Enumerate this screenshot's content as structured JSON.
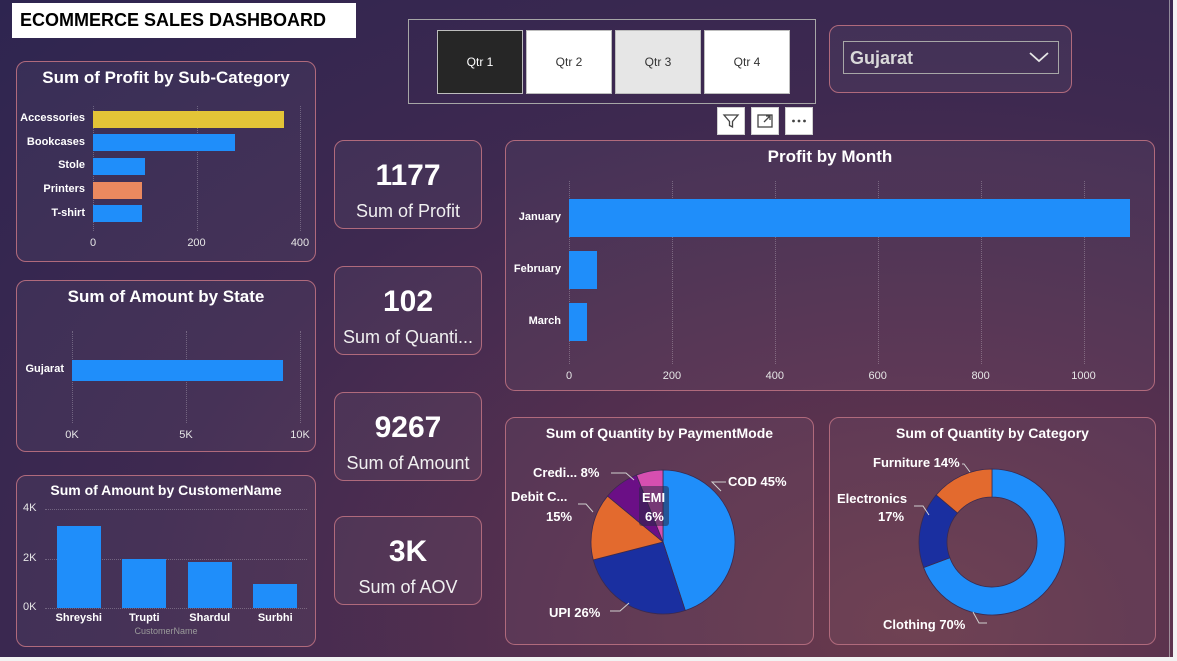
{
  "header": {
    "title": "ECOMMERCE SALES DASHBOARD"
  },
  "quarter_slicer": {
    "options": [
      "Qtr 1",
      "Qtr 2",
      "Qtr 3",
      "Qtr 4"
    ],
    "selected": "Qtr 1"
  },
  "state_dropdown": {
    "value": "Gujarat"
  },
  "visual_toolbar": {
    "icons": [
      "filter-icon",
      "focus-mode-icon",
      "more-options-icon"
    ]
  },
  "kpis": [
    {
      "value": "1177",
      "label": "Sum of Profit"
    },
    {
      "value": "102",
      "label": "Sum of Quanti..."
    },
    {
      "value": "9267",
      "label": "Sum of Amount"
    },
    {
      "value": "3K",
      "label": "Sum of AOV"
    }
  ],
  "colors": {
    "blue": "#1f8efa",
    "yellow": "#e3c437",
    "orange": "#eb895f",
    "navy": "#1a2fa0",
    "purple": "#6b0f86",
    "pink": "#d64fb0",
    "pie_orange": "#e36a2e"
  },
  "chart_data": [
    {
      "type": "bar",
      "orientation": "horizontal",
      "title": "Sum of Profit by Sub-Category",
      "categories": [
        "Accessories",
        "Bookcases",
        "Stole",
        "Printers",
        "T-shirt"
      ],
      "values": [
        370,
        275,
        100,
        95,
        95
      ],
      "colors": [
        "#e3c437",
        "#1f8efa",
        "#1f8efa",
        "#eb895f",
        "#1f8efa"
      ],
      "xlim": [
        0,
        400
      ],
      "ticks": [
        0,
        200,
        400
      ],
      "tick_labels": [
        "0",
        "200",
        "400"
      ]
    },
    {
      "type": "bar",
      "orientation": "horizontal",
      "title": "Sum of Amount by State",
      "categories": [
        "Gujarat"
      ],
      "values": [
        9267
      ],
      "xlim": [
        0,
        10000
      ],
      "ticks": [
        0,
        5000,
        10000
      ],
      "tick_labels": [
        "0K",
        "5K",
        "10K"
      ]
    },
    {
      "type": "bar",
      "orientation": "vertical",
      "title": "Sum of Amount by CustomerName",
      "categories": [
        "Shreyshi",
        "Trupti",
        "Shardul",
        "Surbhi"
      ],
      "values": [
        3300,
        2000,
        1850,
        950
      ],
      "ylim": [
        0,
        4000
      ],
      "ticks": [
        0,
        2000,
        4000
      ],
      "tick_labels": [
        "0K",
        "2K",
        "4K"
      ],
      "xlabel": "CustomerName"
    },
    {
      "type": "bar",
      "orientation": "horizontal",
      "title": "Profit by Month",
      "categories": [
        "January",
        "February",
        "March"
      ],
      "values": [
        1090,
        55,
        35
      ],
      "xlim": [
        0,
        1100
      ],
      "ticks": [
        0,
        200,
        400,
        600,
        800,
        1000
      ],
      "tick_labels": [
        "0",
        "200",
        "400",
        "600",
        "800",
        "1000"
      ]
    },
    {
      "type": "pie",
      "title": "Sum of Quantity by PaymentMode",
      "slices": [
        {
          "label": "COD 45%",
          "value": 45,
          "color": "#1f8efa"
        },
        {
          "label": "UPI 26%",
          "value": 26,
          "color": "#1a2fa0"
        },
        {
          "label": "Debit C...",
          "value": 15,
          "color": "#e36a2e"
        },
        {
          "label": "Credi... 8%",
          "value": 8,
          "color": "#6b0f86"
        },
        {
          "label": "EMI",
          "value": 6,
          "color": "#d64fb0"
        }
      ],
      "extra_labels": {
        "debit_pct": "15%",
        "emi_pct": "6%"
      }
    },
    {
      "type": "pie",
      "variant": "donut",
      "title": "Sum of Quantity by Category",
      "slices": [
        {
          "label": "Clothing 70%",
          "value": 70,
          "color": "#1f8efa"
        },
        {
          "label": "Electronics",
          "value": 17,
          "color": "#1a2fa0"
        },
        {
          "label": "Furniture 14%",
          "value": 14,
          "color": "#e36a2e"
        }
      ],
      "extra_labels": {
        "electronics_pct": "17%"
      }
    }
  ]
}
